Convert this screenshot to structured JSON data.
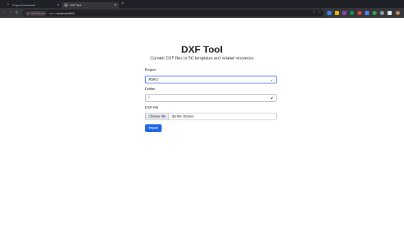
{
  "browser": {
    "tabs": [
      {
        "title": "Project Dashboard",
        "active": false
      },
      {
        "title": "DXF Tool",
        "active": true
      }
    ],
    "new_tab": "+",
    "security_label": "Not Secure",
    "url_prefix": "https://",
    "url_host": "localhost:3000",
    "nav": {
      "back": "←",
      "forward": "→",
      "reload": "↻"
    },
    "extension_colors": [
      "#3b82f6",
      "#f4b400",
      "#8e44ad",
      "#0f9d58",
      "#ea4335",
      "#4285f4",
      "#34a853",
      "#9aa0a6",
      "#e8eaed"
    ]
  },
  "page": {
    "title": "DXF Tool",
    "subtitle": "Convert DXF files to SC templates and related resources",
    "project": {
      "label": "Project",
      "value": "ASKO"
    },
    "folder": {
      "label": "Folder",
      "value": "/"
    },
    "dxf_file": {
      "label": "DXF File",
      "button": "Choose file",
      "status": "No file chosen"
    },
    "import_button": "Import"
  }
}
